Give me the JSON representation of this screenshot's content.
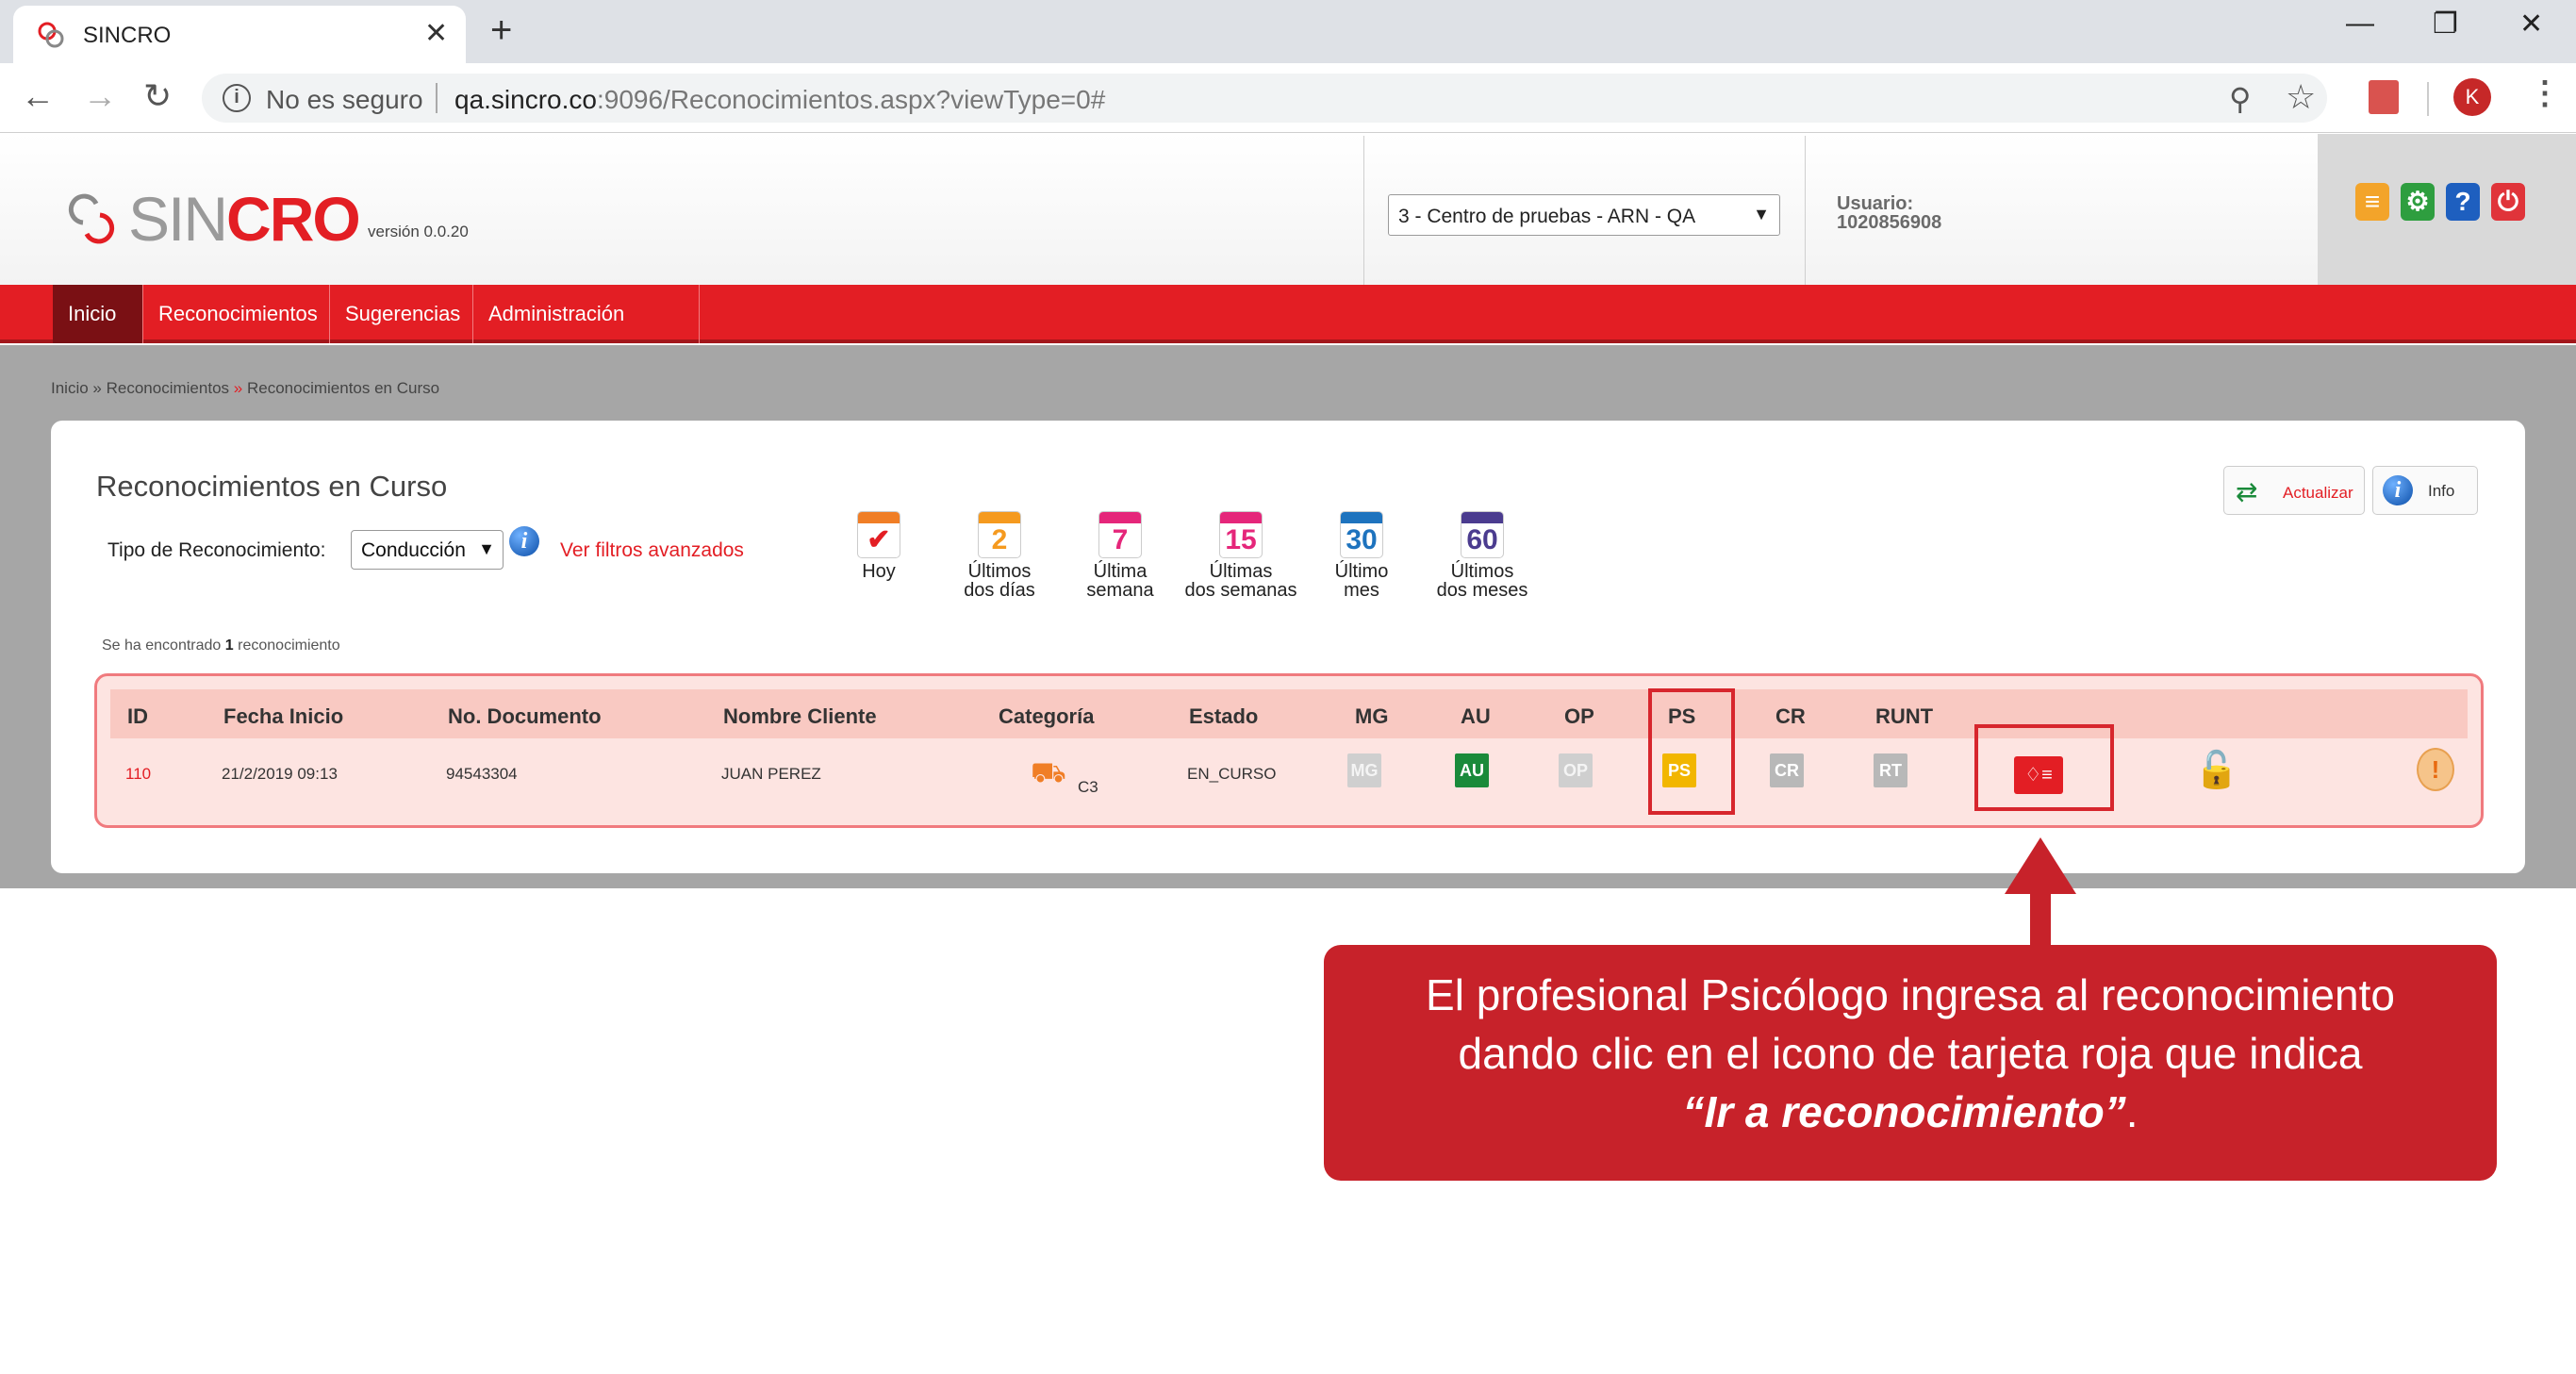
{
  "browser": {
    "tab_title": "SINCRO",
    "new_tab": "+",
    "close_tab": "✕",
    "security_label": "No es seguro",
    "url_host": "qa.sincro.co",
    "url_path": ":9096/Reconocimientos.aspx?viewType=0#",
    "avatar_letter": "K"
  },
  "header": {
    "logo_sin": "SIN",
    "logo_cro": "CRO",
    "version": "versión 0.0.20",
    "center_select_value": "3 - Centro de pruebas - ARN - QA",
    "user_label": "Usuario:",
    "user_id": "1020856908"
  },
  "menu": {
    "items": [
      {
        "label": "Inicio"
      },
      {
        "label": "Reconocimientos"
      },
      {
        "label": "Sugerencias"
      },
      {
        "label": "Administración Centro"
      }
    ]
  },
  "breadcrumb": {
    "home": "Inicio",
    "section": "Reconocimientos",
    "current": "Reconocimientos en Curso",
    "sep": "»"
  },
  "panel": {
    "title": "Reconocimientos en Curso",
    "tipo_label": "Tipo de Reconocimiento:",
    "tipo_value": "Conducción",
    "ver_filtros": "Ver filtros avanzados",
    "actualizar": "Actualizar",
    "info": "Info",
    "found_prefix": "Se ha encontrado",
    "found_count": "1",
    "found_suffix": "reconocimiento"
  },
  "filters": [
    {
      "num": "✔",
      "line1": "Hoy",
      "line2": "",
      "color": "#f07e26"
    },
    {
      "num": "2",
      "line1": "Últimos",
      "line2": "dos días",
      "color": "#f59a1f"
    },
    {
      "num": "7",
      "line1": "Última",
      "line2": "semana",
      "color": "#e5267a"
    },
    {
      "num": "15",
      "line1": "Últimas",
      "line2": "dos semanas",
      "color": "#e5267a"
    },
    {
      "num": "30",
      "line1": "Último",
      "line2": "mes",
      "color": "#1e73be"
    },
    {
      "num": "60",
      "line1": "Últimos",
      "line2": "dos meses",
      "color": "#4b3c8f"
    }
  ],
  "table": {
    "headers": [
      "ID",
      "Fecha Inicio",
      "No. Documento",
      "Nombre Cliente",
      "Categoría",
      "Estado",
      "MG",
      "AU",
      "OP",
      "PS",
      "CR",
      "RUNT"
    ],
    "row": {
      "id": "110",
      "fecha": "21/2/2019 09:13",
      "documento": "94543304",
      "cliente": "JUAN PEREZ",
      "categoria": "C3",
      "estado": "EN_CURSO",
      "mg": "MG",
      "au": "AU",
      "op": "OP",
      "ps": "PS",
      "cr": "CR",
      "rt": "RT"
    }
  },
  "callout": {
    "line1": "El profesional Psicólogo ingresa al reconocimiento",
    "line2": "dando clic en el icono de tarjeta roja que indica",
    "emphasis": "“Ir a reconocimiento”",
    "end": "."
  },
  "colors": {
    "brand_red": "#e31e24",
    "callout_red": "#c7222a"
  }
}
